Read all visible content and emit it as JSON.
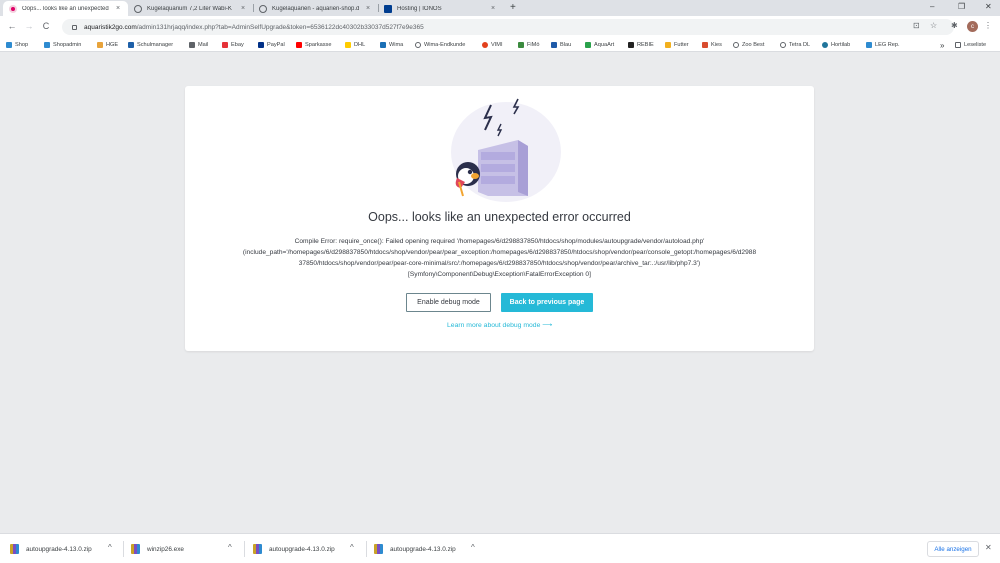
{
  "tabs": [
    {
      "title": "Oops... looks like an unexpected",
      "active": true,
      "favicon": "prestashop-icon",
      "color": "#df0067"
    },
    {
      "title": "Kugelaquarium 7,2 Liter Wabi-K",
      "active": false,
      "favicon": "globe-icon",
      "color": "#5f6368"
    },
    {
      "title": "Kugelaquarien - aquarien-shop.d",
      "active": false,
      "favicon": "globe-icon",
      "color": "#5f6368"
    },
    {
      "title": "Hosting | IONOS",
      "active": false,
      "favicon": "ionos-icon",
      "color": "#003d8f"
    }
  ],
  "tab_close_glyph": "×",
  "new_tab_glyph": "+",
  "window_controls": [
    "–",
    "❐",
    "✕"
  ],
  "url": {
    "host": "aquaristik2go.com",
    "path": "/admin131hrjaqq/index.php?tab=AdminSelfUpgrade&token=6536122dc40302b33037d527f7e9e365"
  },
  "nav": {
    "back": "←",
    "forward": "→",
    "reload": "C"
  },
  "avatar_letter": "c",
  "bookmarks": [
    {
      "label": "Shop",
      "color": "#2e8bd0"
    },
    {
      "label": "Shopadmin",
      "color": "#2e8bd0"
    },
    {
      "label": "HGE",
      "color": "#e8a33b"
    },
    {
      "label": "Schulmanager",
      "color": "#1d5fa8"
    },
    {
      "label": "Mail",
      "color": "#5f6368"
    },
    {
      "label": "Ebay",
      "color": "#e53238"
    },
    {
      "label": "PayPal",
      "color": "#003087"
    },
    {
      "label": "Sparkasse",
      "color": "#ff0000"
    },
    {
      "label": "DHL",
      "color": "#ffcc00"
    },
    {
      "label": "Wima",
      "color": "#1a6fb5"
    },
    {
      "label": "Wima-Endkunde",
      "color": "#5f6368"
    },
    {
      "label": "VIMI",
      "color": "#e2401c"
    },
    {
      "label": "FiMö",
      "color": "#3b8a3e"
    },
    {
      "label": "Blau",
      "color": "#1e5aa8"
    },
    {
      "label": "AquaArt",
      "color": "#2aa14b"
    },
    {
      "label": "REBIE",
      "color": "#222222"
    },
    {
      "label": "Futter",
      "color": "#f2b01e"
    },
    {
      "label": "Kies",
      "color": "#d84c2f"
    },
    {
      "label": "Zoo Best",
      "color": "#5f6368"
    },
    {
      "label": "Tetra DL",
      "color": "#5f6368"
    },
    {
      "label": "Hortilab",
      "color": "#21759b"
    },
    {
      "label": "LEG Rep.",
      "color": "#2e8bd0"
    }
  ],
  "bookmarks_overflow": "»",
  "reading_list": "Leseliste",
  "error": {
    "title": "Oops... looks like an unexpected error occurred",
    "line1": "Compile Error: require_once(): Failed opening required '/homepages/6/d298837850/htdocs/shop/modules/autoupgrade/vendor/autoload.php'",
    "line2": "(include_path='/homepages/6/d298837850/htdocs/shop/vendor/pear/pear_exception:/homepages/6/d298837850/htdocs/shop/vendor/pear/console_getopt:/homepages/6/d2988",
    "line3": "37850/htdocs/shop/vendor/pear/pear-core-minimal/src/:/homepages/6/d298837850/htdocs/shop/vendor/pear/archive_tar:.:/usr/lib/php7.3')",
    "line4": "[Symfony\\Component\\Debug\\Exception\\FatalErrorException 0]",
    "debug_button": "Enable debug mode",
    "back_button": "Back to previous page",
    "learn_more": "Learn more about debug mode ⟶",
    "accent_color": "#25b9d7"
  },
  "downloads": [
    {
      "file": "autoupgrade-4.13.0.zip"
    },
    {
      "file": "winzip26.exe"
    },
    {
      "file": "autoupgrade-4.13.0.zip"
    },
    {
      "file": "autoupgrade-4.13.0.zip"
    }
  ],
  "download_chevron": "^",
  "show_all": "Alle anzeigen",
  "download_close": "✕"
}
